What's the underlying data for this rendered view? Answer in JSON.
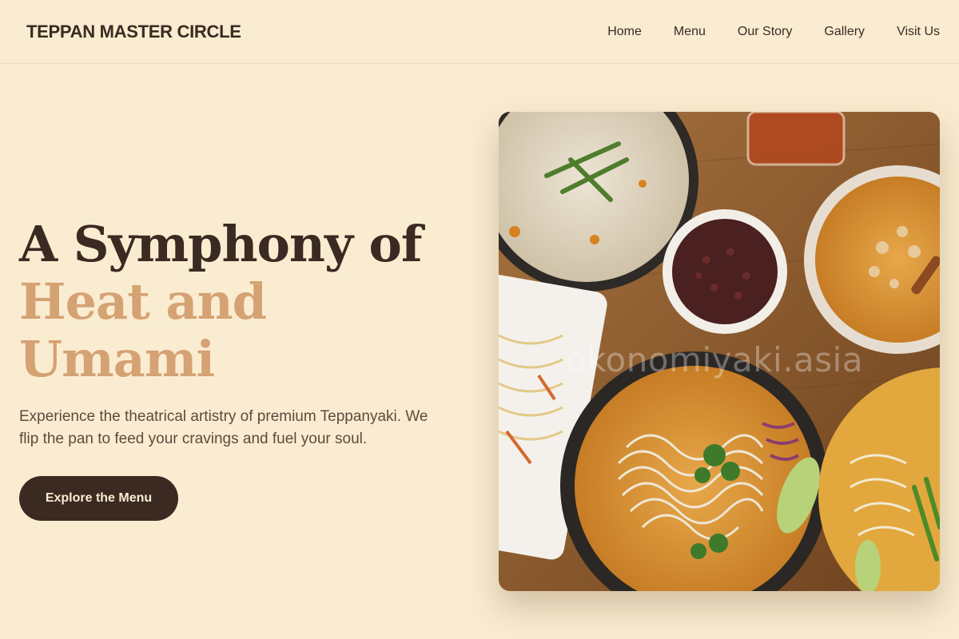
{
  "brand": {
    "name": "TEPPAN MASTER CIRCLE"
  },
  "nav": {
    "items": [
      {
        "label": "Home"
      },
      {
        "label": "Menu"
      },
      {
        "label": "Our Story"
      },
      {
        "label": "Gallery"
      },
      {
        "label": "Visit Us"
      }
    ]
  },
  "hero": {
    "headline_line1": "A Symphony of",
    "headline_line2": "Heat and Umami",
    "description": "Experience the theatrical artistry of premium Teppanyaki. We flip the pan to feed your cravings and fuel your soul.",
    "cta_label": "Explore the Menu",
    "image": {
      "subject": "overhead photo of Thai/Asian curry noodle dishes, rice and salads on a wooden table",
      "watermark": "okonomiyaki.asia"
    }
  },
  "colors": {
    "background": "#faecd0",
    "text_dark": "#3b2a22",
    "accent": "#d5a273",
    "button_bg": "#3b2a22",
    "button_text": "#faecd0"
  }
}
